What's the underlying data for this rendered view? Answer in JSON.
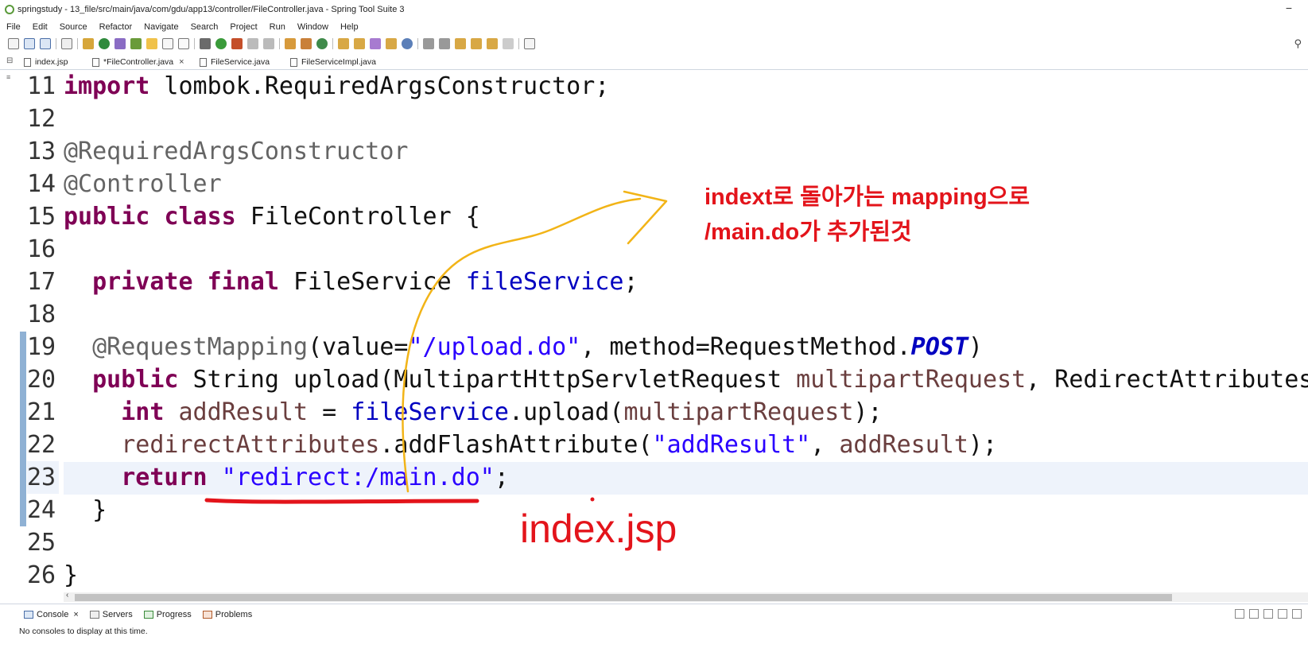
{
  "window": {
    "title": "springstudy - 13_file/src/main/java/com/gdu/app13/controller/FileController.java - Spring Tool Suite 3",
    "minimize_glyph": "−"
  },
  "menu": [
    "File",
    "Edit",
    "Source",
    "Refactor",
    "Navigate",
    "Search",
    "Project",
    "Run",
    "Window",
    "Help"
  ],
  "tabs": [
    {
      "label": "index.jsp",
      "active": false
    },
    {
      "label": "*FileController.java",
      "active": true,
      "close": "×"
    },
    {
      "label": "FileService.java",
      "active": false
    },
    {
      "label": "FileServiceImpl.java",
      "active": false
    }
  ],
  "line_numbers": [
    "11",
    "12",
    "13",
    "14",
    "15",
    "16",
    "17",
    "18",
    "19",
    "20",
    "21",
    "22",
    "23",
    "24",
    "25",
    "26"
  ],
  "annotations": {
    "note_line1": "indext로 돌아가는 mapping으로",
    "note_line2": "/main.do가 추가된것",
    "handwritten": "index.jsp",
    "color": "#e3141b"
  },
  "bottom_panel": {
    "tabs": [
      {
        "label": "Console",
        "close": "×"
      },
      {
        "label": "Servers"
      },
      {
        "label": "Progress"
      },
      {
        "label": "Problems"
      }
    ],
    "message": "No consoles to display at this time."
  },
  "colors": {
    "keyword": "#7f0055",
    "string": "#2a00ff",
    "field": "#0000c0",
    "annotation": "#646464",
    "local_var": "#6a3e3e",
    "current_line": "#eef3fb",
    "change_bar": "#8fb1d4"
  }
}
